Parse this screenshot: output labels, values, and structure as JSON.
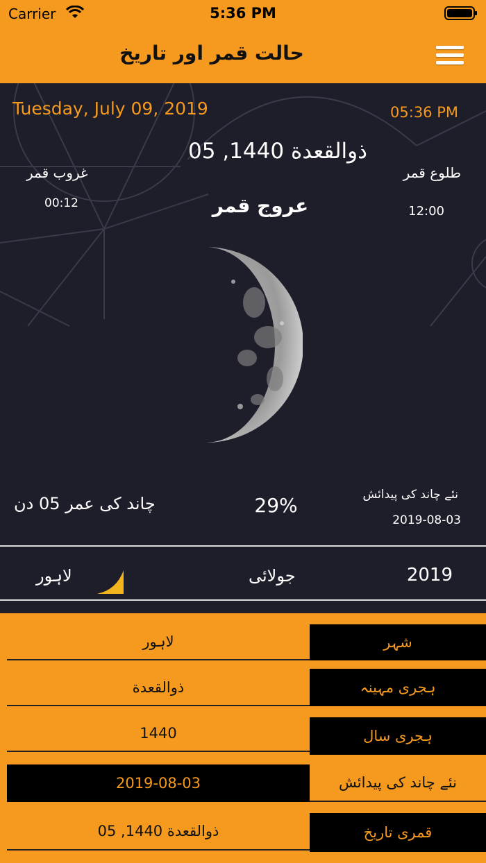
{
  "status_bar": {
    "carrier": "Carrier",
    "time": "5:36 PM"
  },
  "nav": {
    "title": "حالت قمر اور تاریخ",
    "menu_icon": "hamburger-icon"
  },
  "moon_panel": {
    "gregorian_date": "Tuesday, July 09, 2019",
    "current_time": "05:36 PM",
    "hijri_date": "05 ,ذوالقعدة 1440",
    "moonset_label": "غروب قمر",
    "moonset_time": "00:12",
    "moonrise_label": "طلوع قمر",
    "moonrise_time": "12:00",
    "transit_label": "عروج قمر",
    "moon_age": "چاند کی عمر 05 دن",
    "illumination": "29%",
    "illumination_fraction": 0.29,
    "new_moon_label": "نئے چاند کی پیدائش",
    "new_moon_date": "2019-08-03"
  },
  "summary_row": {
    "city": "لاہور",
    "month": "جولائی",
    "year": "2019"
  },
  "info_table": [
    {
      "key": "شہر",
      "value": "لاہور"
    },
    {
      "key": "ہجری مہینہ",
      "value": "ذوالقعدة"
    },
    {
      "key": "ہجری سال",
      "value": "1440"
    },
    {
      "key": "نئے چاند کی پیدائش",
      "value": "2019-08-03"
    },
    {
      "key": "قمری تاریخ",
      "value": "05 ,ذوالقعدة 1440"
    }
  ],
  "colors": {
    "accent": "#f59a1e",
    "panel": "#1e1e2a",
    "text_light": "#ffffff"
  }
}
